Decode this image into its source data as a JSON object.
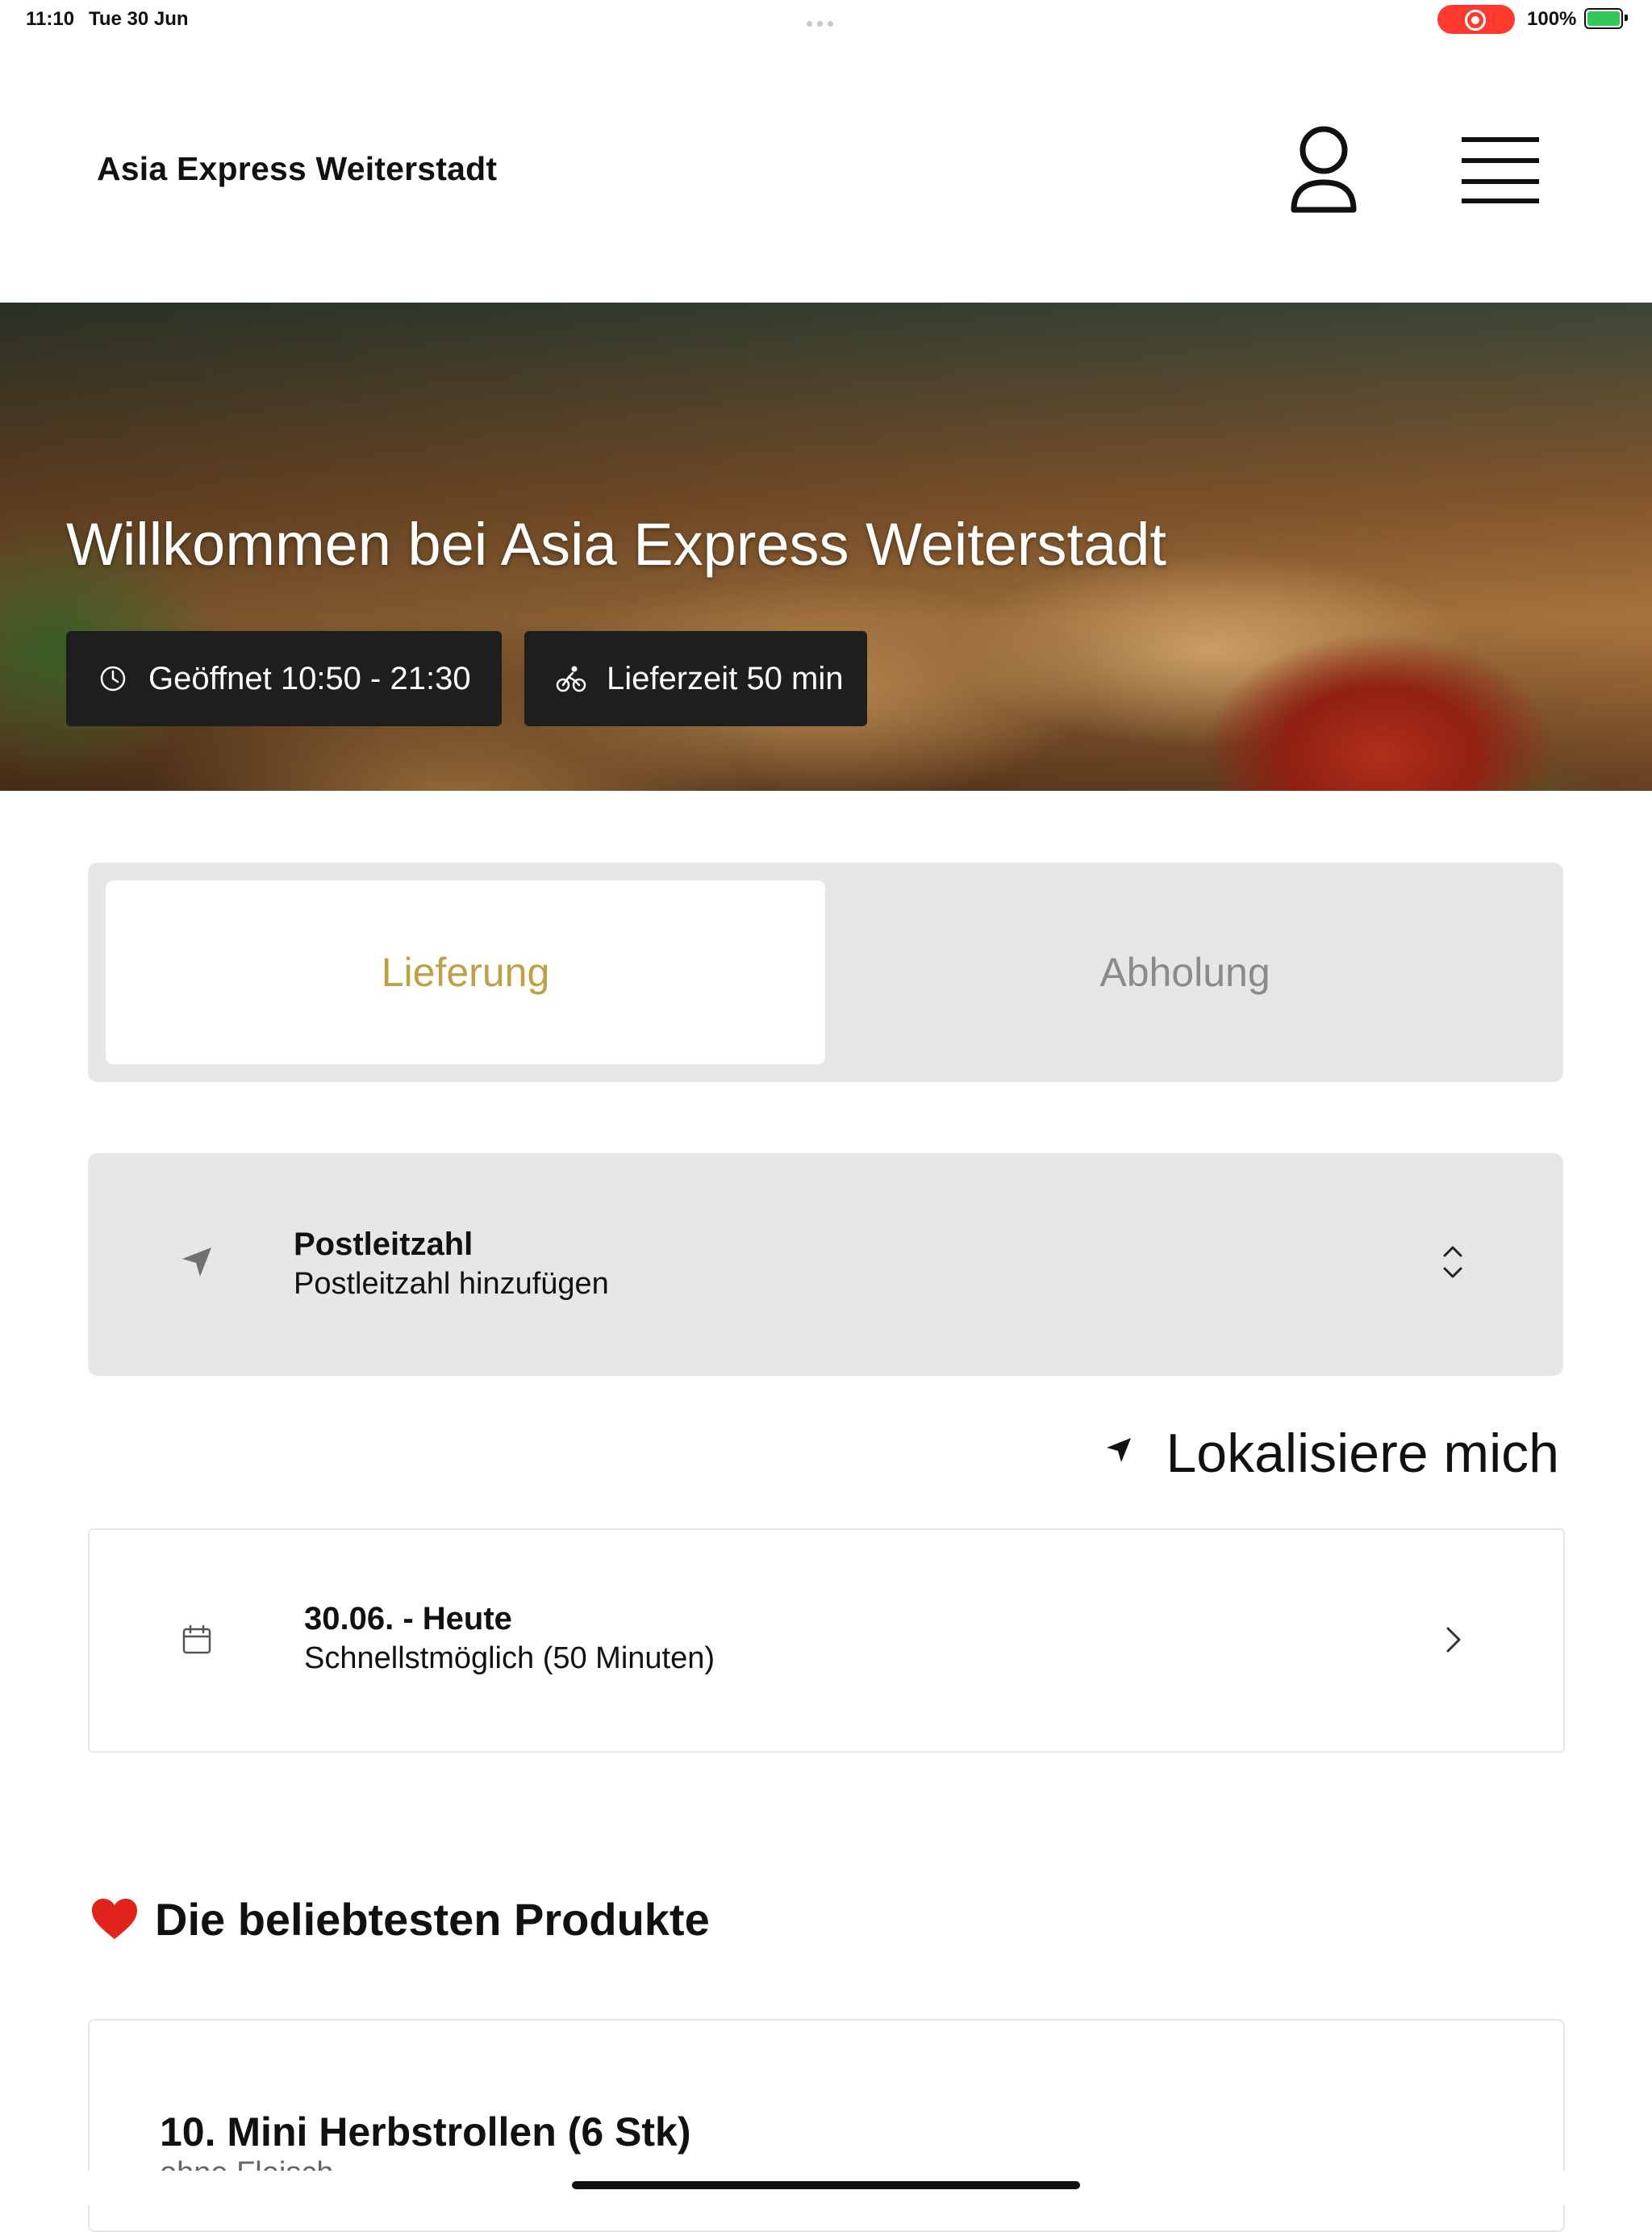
{
  "status_bar": {
    "time": "11:10",
    "date": "Tue 30 Jun",
    "battery": "100%"
  },
  "header": {
    "brand": "Asia Express Weiterstadt"
  },
  "hero": {
    "title": "Willkommen bei Asia Express Weiterstadt",
    "opening_hours": "Geöffnet 10:50 - 21:30",
    "delivery_time": "Lieferzeit 50 min"
  },
  "order_mode": {
    "options": [
      "Lieferung",
      "Abholung"
    ],
    "selected": "Lieferung"
  },
  "postcode": {
    "label": "Postleitzahl",
    "placeholder": "Postleitzahl hinzufügen"
  },
  "locate": {
    "label": "Lokalisiere mich"
  },
  "schedule": {
    "date": "30.06. - Heute",
    "time": "Schnellstmöglich (50 Minuten)"
  },
  "popular": {
    "title": "Die beliebtesten Produkte",
    "items": [
      {
        "name": "10. Mini Herbstrollen (6 Stk)",
        "description": "ohne Fleisch"
      }
    ]
  },
  "colors": {
    "accent": "#bda048",
    "chip_bg": "#1e1e1e",
    "panel_bg": "#e6e6e6",
    "heart": "#e0231b"
  },
  "icons": [
    "clock-icon",
    "bike-icon",
    "user-icon",
    "menu-icon",
    "location-arrow-icon",
    "updown-chevron-icon",
    "calendar-icon",
    "chevron-right-icon",
    "heart-icon"
  ]
}
